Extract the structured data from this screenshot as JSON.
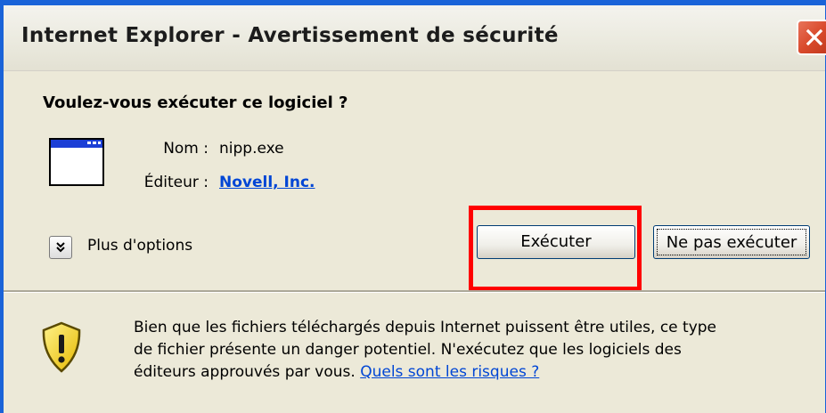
{
  "window": {
    "title": "Internet Explorer - Avertissement de sécurité"
  },
  "dialog": {
    "question": "Voulez-vous exécuter ce logiciel ?",
    "name_label": "Nom :",
    "name_value": "nipp.exe",
    "publisher_label": "Éditeur :",
    "publisher_value": "Novell, Inc.",
    "more_options_label": "Plus d'options",
    "run_button_label": "Exécuter",
    "dont_run_button_label": "Ne pas exécuter"
  },
  "warning": {
    "line1": "Bien que les fichiers téléchargés depuis Internet puissent être utiles, ce type",
    "line2": "de fichier présente un danger potentiel. N'exécutez que les logiciels des",
    "line3": "éditeurs approuvés par vous.",
    "risks_link": "Quels sont les risques ?"
  },
  "icons": {
    "program": "program-window-icon",
    "warning": "security-shield-warning-icon",
    "close": "close-icon",
    "more": "double-chevron-down-icon"
  },
  "colors": {
    "highlight": "#ff0000",
    "link": "#0046d5",
    "titlebar_border": "#1a63d8"
  }
}
